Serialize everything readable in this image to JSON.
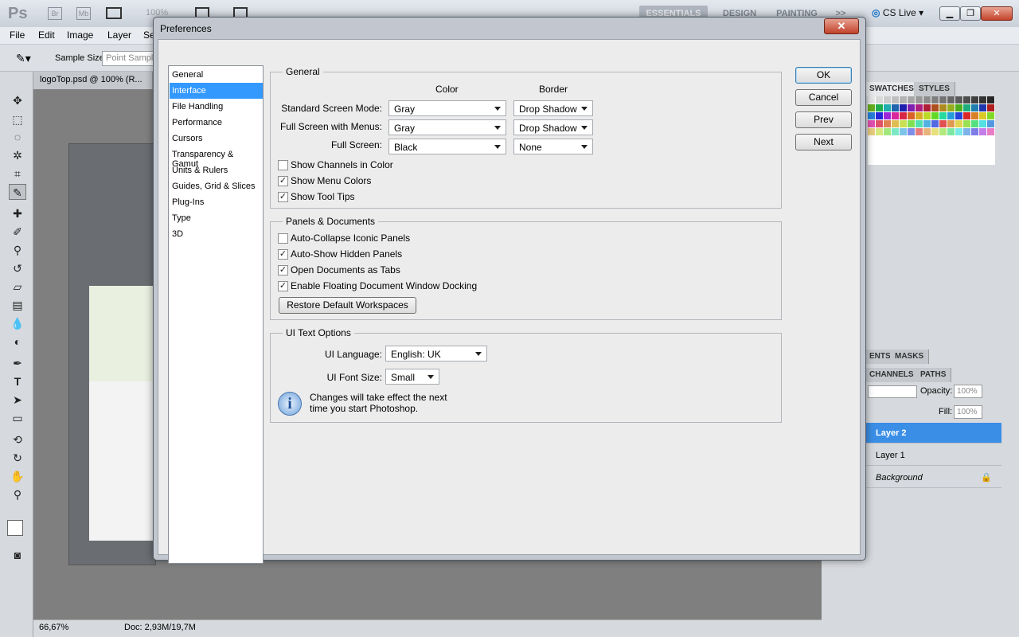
{
  "app": {
    "logo": "Ps",
    "bridge": "Br",
    "minibridge": "Mb",
    "zoom_combo": "100%",
    "workspaces": [
      "ESSENTIALS",
      "DESIGN",
      "PAINTING"
    ],
    "more_workspaces": ">>",
    "cs_live": "CS Live"
  },
  "menu": [
    "File",
    "Edit",
    "Image",
    "Layer",
    "Se"
  ],
  "options": {
    "sample_size_label": "Sample Size:",
    "sample_size_value": "Point Sample"
  },
  "document": {
    "tab_title": "logoTop.psd @ 100% (R...",
    "zoom": "66,67%",
    "doc_size": "Doc: 2,93M/19,7M"
  },
  "panels": {
    "swatches_tab": "SWATCHES",
    "styles_tab": "STYLES",
    "adjustments_tab": "ENTS",
    "masks_tab": "MASKS",
    "channels_tab": "CHANNELS",
    "paths_tab": "PATHS",
    "opacity_label": "Opacity:",
    "opacity_value": "100%",
    "fill_label": "Fill:",
    "fill_value": "100%",
    "layers": [
      "Layer 2",
      "Layer 1",
      "Background"
    ]
  },
  "dialog": {
    "title": "Preferences",
    "close": "✕",
    "categories": [
      "General",
      "Interface",
      "File Handling",
      "Performance",
      "Cursors",
      "Transparency & Gamut",
      "Units & Rulers",
      "Guides, Grid & Slices",
      "Plug-Ins",
      "Type",
      "3D"
    ],
    "selected_category": "Interface",
    "buttons": {
      "ok": "OK",
      "cancel": "Cancel",
      "prev": "Prev",
      "next": "Next"
    },
    "general": {
      "legend": "General",
      "color_header": "Color",
      "border_header": "Border",
      "rows": [
        {
          "label": "Standard Screen Mode:",
          "color": "Gray",
          "border": "Drop Shadow"
        },
        {
          "label": "Full Screen with Menus:",
          "color": "Gray",
          "border": "Drop Shadow"
        },
        {
          "label": "Full Screen:",
          "color": "Black",
          "border": "None"
        }
      ],
      "checks": [
        {
          "label": "Show Channels in Color",
          "checked": false
        },
        {
          "label": "Show Menu Colors",
          "checked": true
        },
        {
          "label": "Show Tool Tips",
          "checked": true
        }
      ]
    },
    "panels_docs": {
      "legend": "Panels & Documents",
      "checks": [
        {
          "label": "Auto-Collapse Iconic Panels",
          "checked": false
        },
        {
          "label": "Auto-Show Hidden Panels",
          "checked": true
        },
        {
          "label": "Open Documents as Tabs",
          "checked": true
        },
        {
          "label": "Enable Floating Document Window Docking",
          "checked": true
        }
      ],
      "restore_button": "Restore Default Workspaces"
    },
    "ui_text": {
      "legend": "UI Text Options",
      "language_label": "UI Language:",
      "language_value": "English: UK",
      "font_size_label": "UI Font Size:",
      "font_size_value": "Small",
      "info_line1": "Changes will take effect the next",
      "info_line2": "time you start Photoshop."
    }
  },
  "colors": {
    "selection": "#3399ff",
    "layer_selected": "#3a8ee6",
    "dialog_bg": "#ececec"
  }
}
